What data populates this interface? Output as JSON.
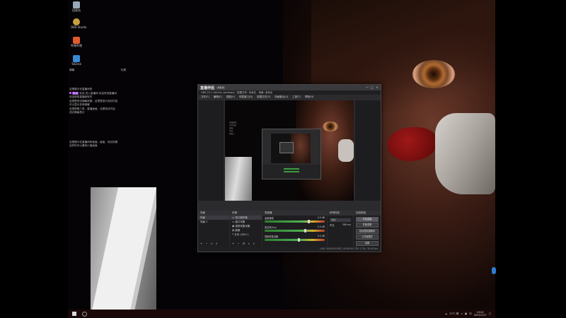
{
  "desktop": {
    "icons": [
      {
        "name": "recycle-bin-icon",
        "label": "回收站",
        "color": "#9aa8b8"
      },
      {
        "name": "obs-shortcut-icon",
        "label": "OBS Studio",
        "color": "#c8a040"
      },
      {
        "name": "app-icon-red",
        "label": "哔哩哔哩",
        "color": "#e05a30"
      },
      {
        "name": "app-icon-blue",
        "label": "ToDesk",
        "color": "#3a8ad8"
      }
    ]
  },
  "chat": {
    "header_left": "弹幕",
    "header_right": "礼物",
    "lines": [
      "这是展示在直播间的",
      "欢迎 进入直播间 欢迎来到直播间",
      "",
      "欢迎使用直播姬软件",
      "这里是测试弹幕效果，这里是显示测试内容",
      "可以显示多条弹幕",
      "这里是第三条，直播画面，也是测试内容",
      "测试弹幕显示",
      "",
      "",
      "这是展示在直播间的画面，画面，测试效果",
      "这样你可以看到小窗画面"
    ]
  },
  "obs": {
    "brand": "直播伴侣",
    "badge": "V4.0",
    "window_title": "OBS 29.1 (64-bit, windows) - 配置文件: 未命名 - 场景: 未命名",
    "menu": [
      "文件(F)",
      "编辑(E)",
      "视图(V)",
      "停靠窗口(D)",
      "配置文件(P)",
      "场景集合(S)",
      "工具(T)",
      "帮助(H)"
    ],
    "window_controls": [
      "—",
      "□",
      "×"
    ],
    "preview_text": [
      "直播画面",
      "实时预览",
      "画面一",
      "测试",
      "画面二"
    ],
    "panels": {
      "scenes": {
        "title": "场景",
        "items": [
          "场景",
          "场景 2"
        ]
      },
      "sources": {
        "title": "来源",
        "items": [
          "显示器采集",
          "窗口采集",
          "视频采集设备",
          "图像",
          "文本 (GDI+)"
        ]
      },
      "mixer": {
        "title": "混音器",
        "channels": [
          {
            "label": "桌面音频",
            "db": "0.0 dB",
            "level": 0.72
          },
          {
            "label": "麦克风/Aux",
            "db": "0.0 dB",
            "level": 0.66
          },
          {
            "label": "视频采集设备",
            "db": "0.0 dB",
            "level": 0.55
          }
        ]
      },
      "transitions": {
        "title": "转场特效",
        "selected": "淡出",
        "duration_label": "时长",
        "duration": "300 ms"
      },
      "controls": {
        "title": "控制按钮",
        "buttons": [
          "开始直播",
          "开始录制",
          "启动虚拟摄像机",
          "工作室模式",
          "设置",
          "退出"
        ]
      }
    },
    "status": "LIVE: 00:00:00   REC: 00:00:00   CPU: 2.3%, 30.00 fps"
  },
  "taskbar": {
    "tray_text": "27℃ 晴",
    "ime": "中",
    "time": "19:02",
    "date": "2023/7/27"
  }
}
